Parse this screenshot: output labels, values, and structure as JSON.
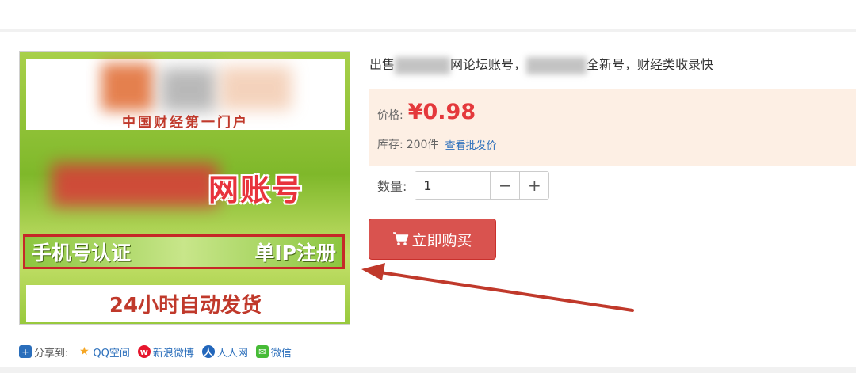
{
  "product_image": {
    "tagline": "中国财经第一门户",
    "title_suffix": "网账号",
    "band_left": "手机号认证",
    "band_right": "单IP注册",
    "bottom_text": "24小时自动发货"
  },
  "product": {
    "title_part1": "出售",
    "title_part2": "网论坛账号，",
    "title_part3": "全新号，财经类收录快",
    "price_label": "价格:",
    "price_value": "¥0.98",
    "stock_label": "库存:",
    "stock_value": "200件",
    "wholesale_link": "查看批发价",
    "quantity_label": "数量:",
    "quantity_value": "1",
    "minus": "−",
    "plus": "+",
    "buy_label": "立即购买"
  },
  "share": {
    "label": "分享到:",
    "items": [
      {
        "label": "QQ空间",
        "icon": "qzone-icon",
        "color": "#f5a623"
      },
      {
        "label": "新浪微博",
        "icon": "weibo-icon",
        "color": "#e6162d"
      },
      {
        "label": "人人网",
        "icon": "renren-icon",
        "color": "#2266bb"
      },
      {
        "label": "微信",
        "icon": "wechat-icon",
        "color": "#46bb36"
      }
    ]
  },
  "colors": {
    "accent_red": "#e4393c",
    "buy_button": "#d9534f",
    "link_blue": "#2a6ebb",
    "price_bg": "#fdefe4"
  }
}
